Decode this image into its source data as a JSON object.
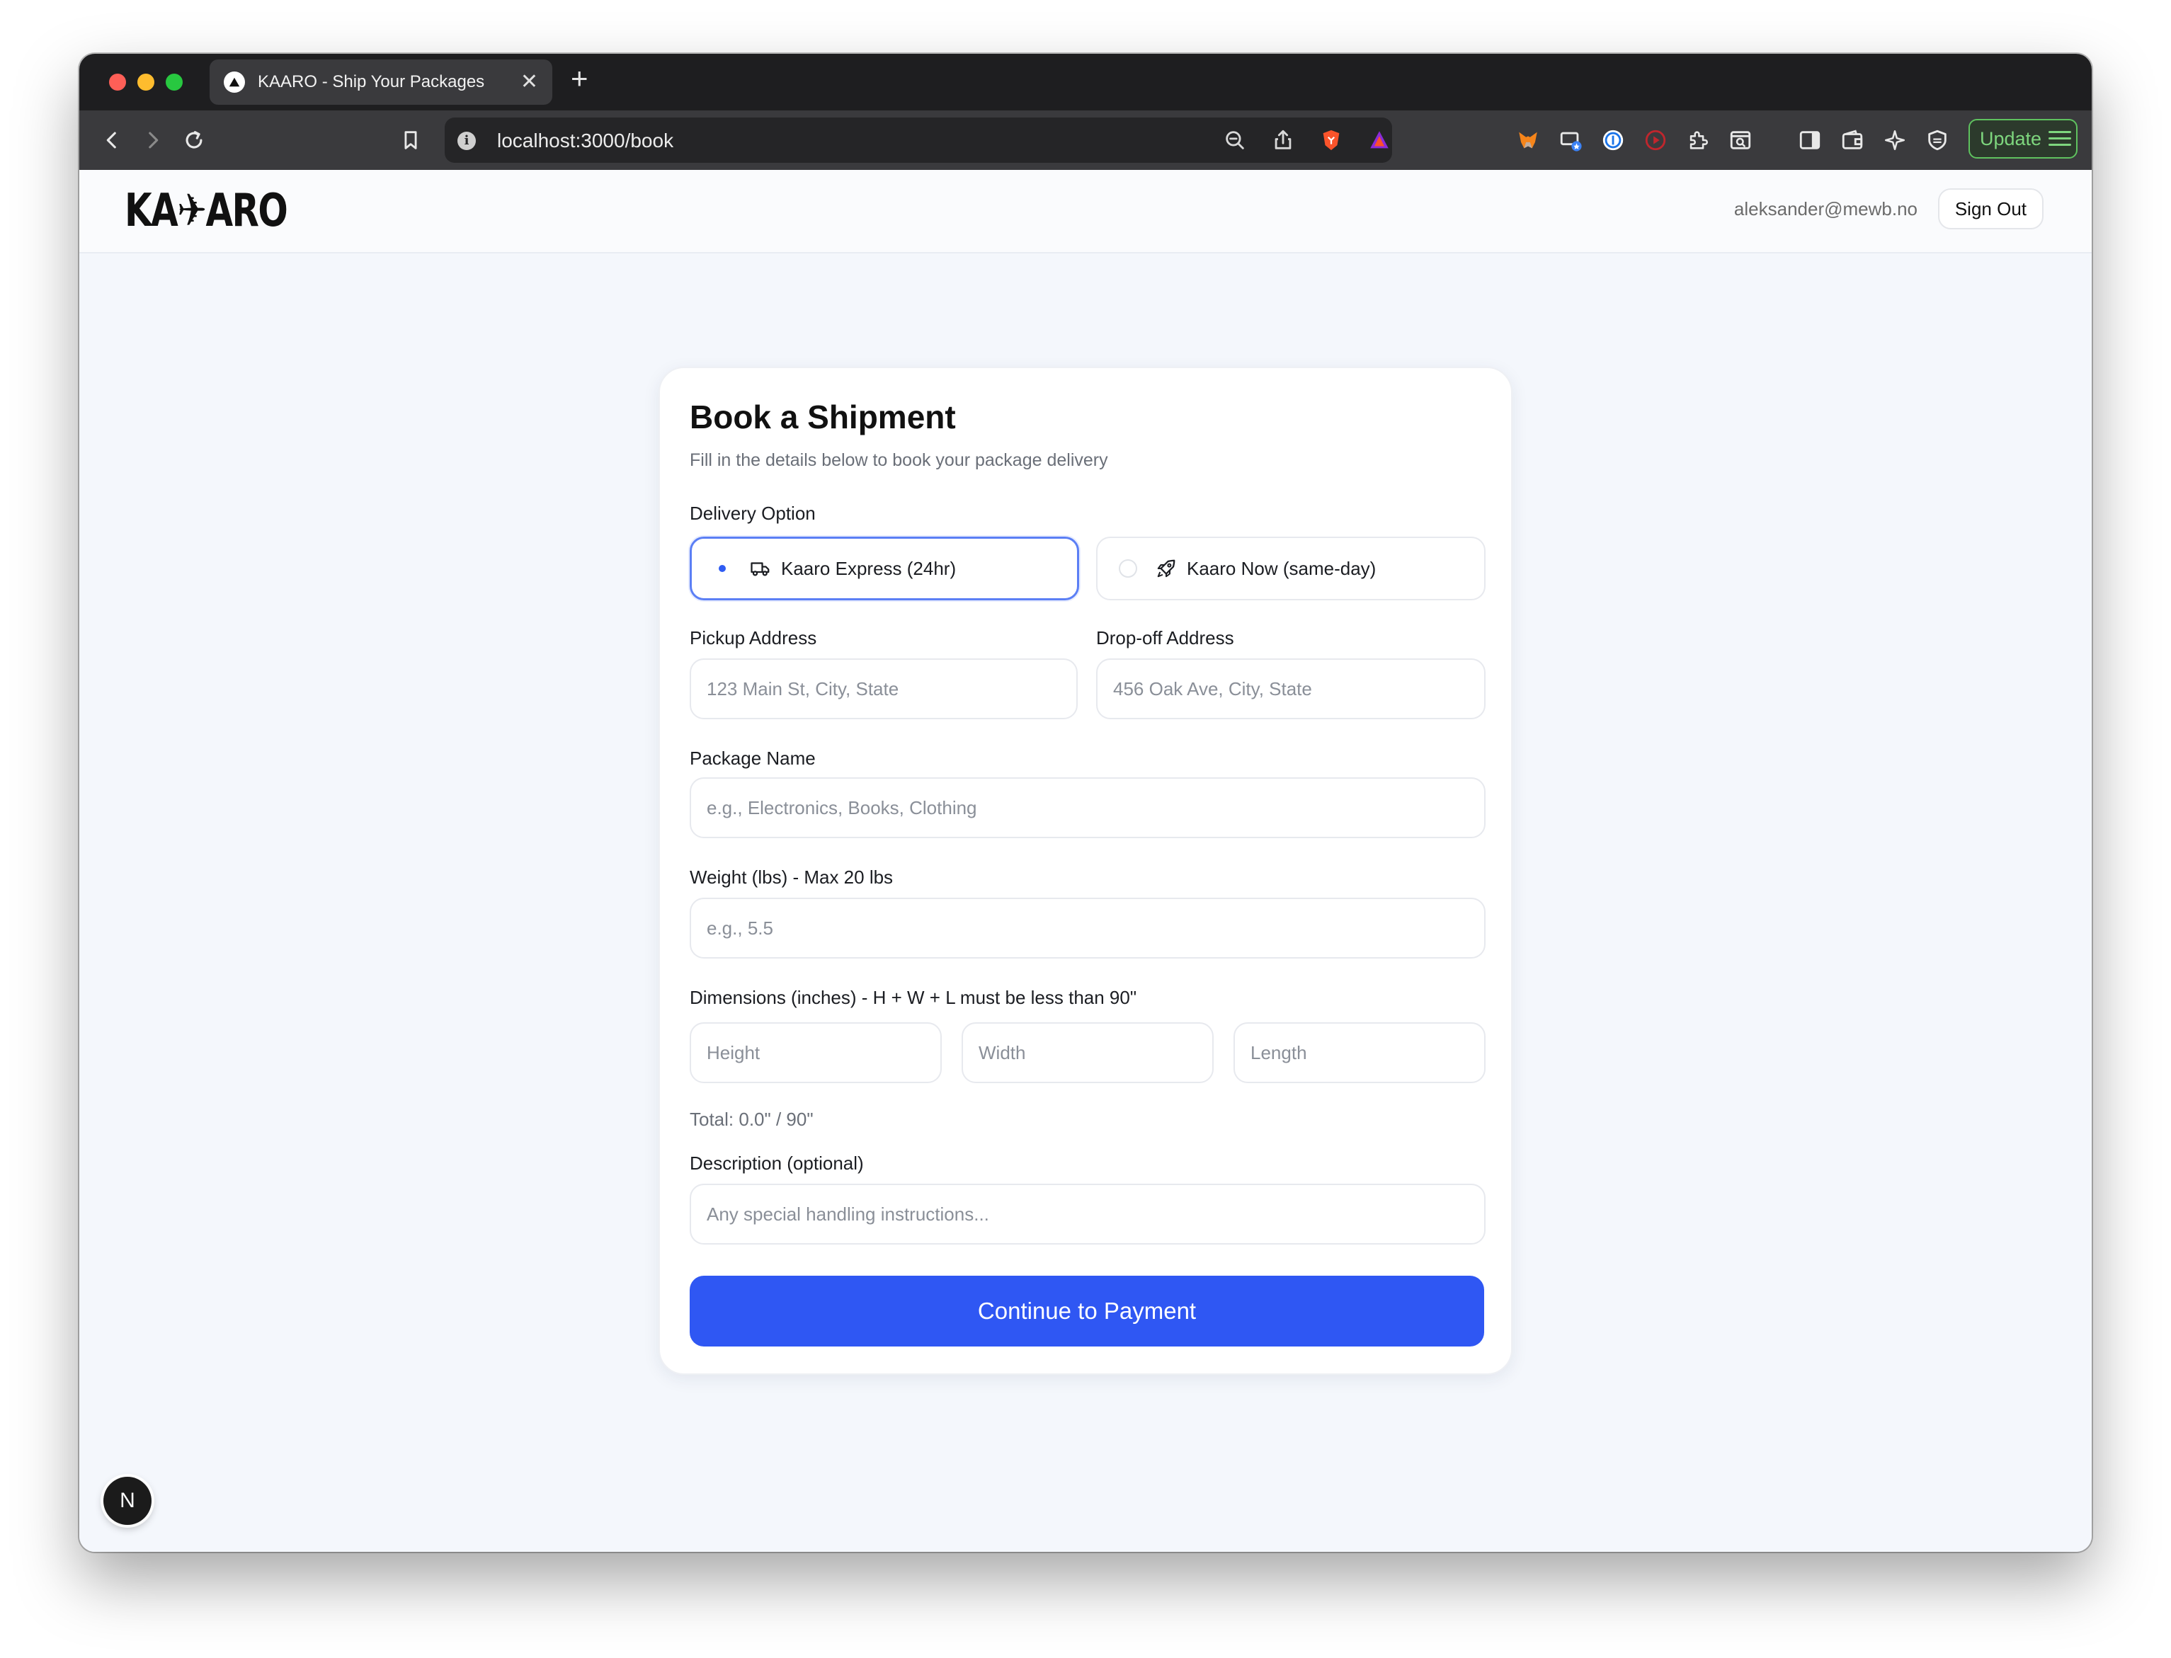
{
  "browser": {
    "tab_title": "KAARO - Ship Your Packages",
    "tab_close": "✕",
    "new_tab": "+",
    "url": "localhost:3000/book",
    "update_label": "Update"
  },
  "header": {
    "logo_text": "KA✈ARO",
    "user_email": "aleksander@mewb.no",
    "sign_out": "Sign Out"
  },
  "form": {
    "title": "Book a Shipment",
    "subtitle": "Fill in the details below to book your package delivery",
    "delivery_label": "Delivery Option",
    "options": [
      {
        "label": "Kaaro Express (24hr)",
        "selected": true,
        "icon": "truck-icon"
      },
      {
        "label": "Kaaro Now (same-day)",
        "selected": false,
        "icon": "rocket-icon"
      }
    ],
    "pickup_label": "Pickup Address",
    "pickup_placeholder": "123 Main St, City, State",
    "dropoff_label": "Drop-off Address",
    "dropoff_placeholder": "456 Oak Ave, City, State",
    "package_label": "Package Name",
    "package_placeholder": "e.g., Electronics, Books, Clothing",
    "weight_label": "Weight (lbs) - Max 20 lbs",
    "weight_placeholder": "e.g., 5.5",
    "dimensions_label": "Dimensions (inches) - H + W + L must be less than 90\"",
    "height_placeholder": "Height",
    "width_placeholder": "Width",
    "length_placeholder": "Length",
    "total_text": "Total: 0.0\" / 90\"",
    "description_label": "Description (optional)",
    "description_placeholder": "Any special handling instructions...",
    "submit_label": "Continue to Payment"
  },
  "dev_badge": "N",
  "colors": {
    "accent": "#2f57f3",
    "selected_border": "#5b7ff5",
    "page_bg": "#f4f7fc"
  }
}
